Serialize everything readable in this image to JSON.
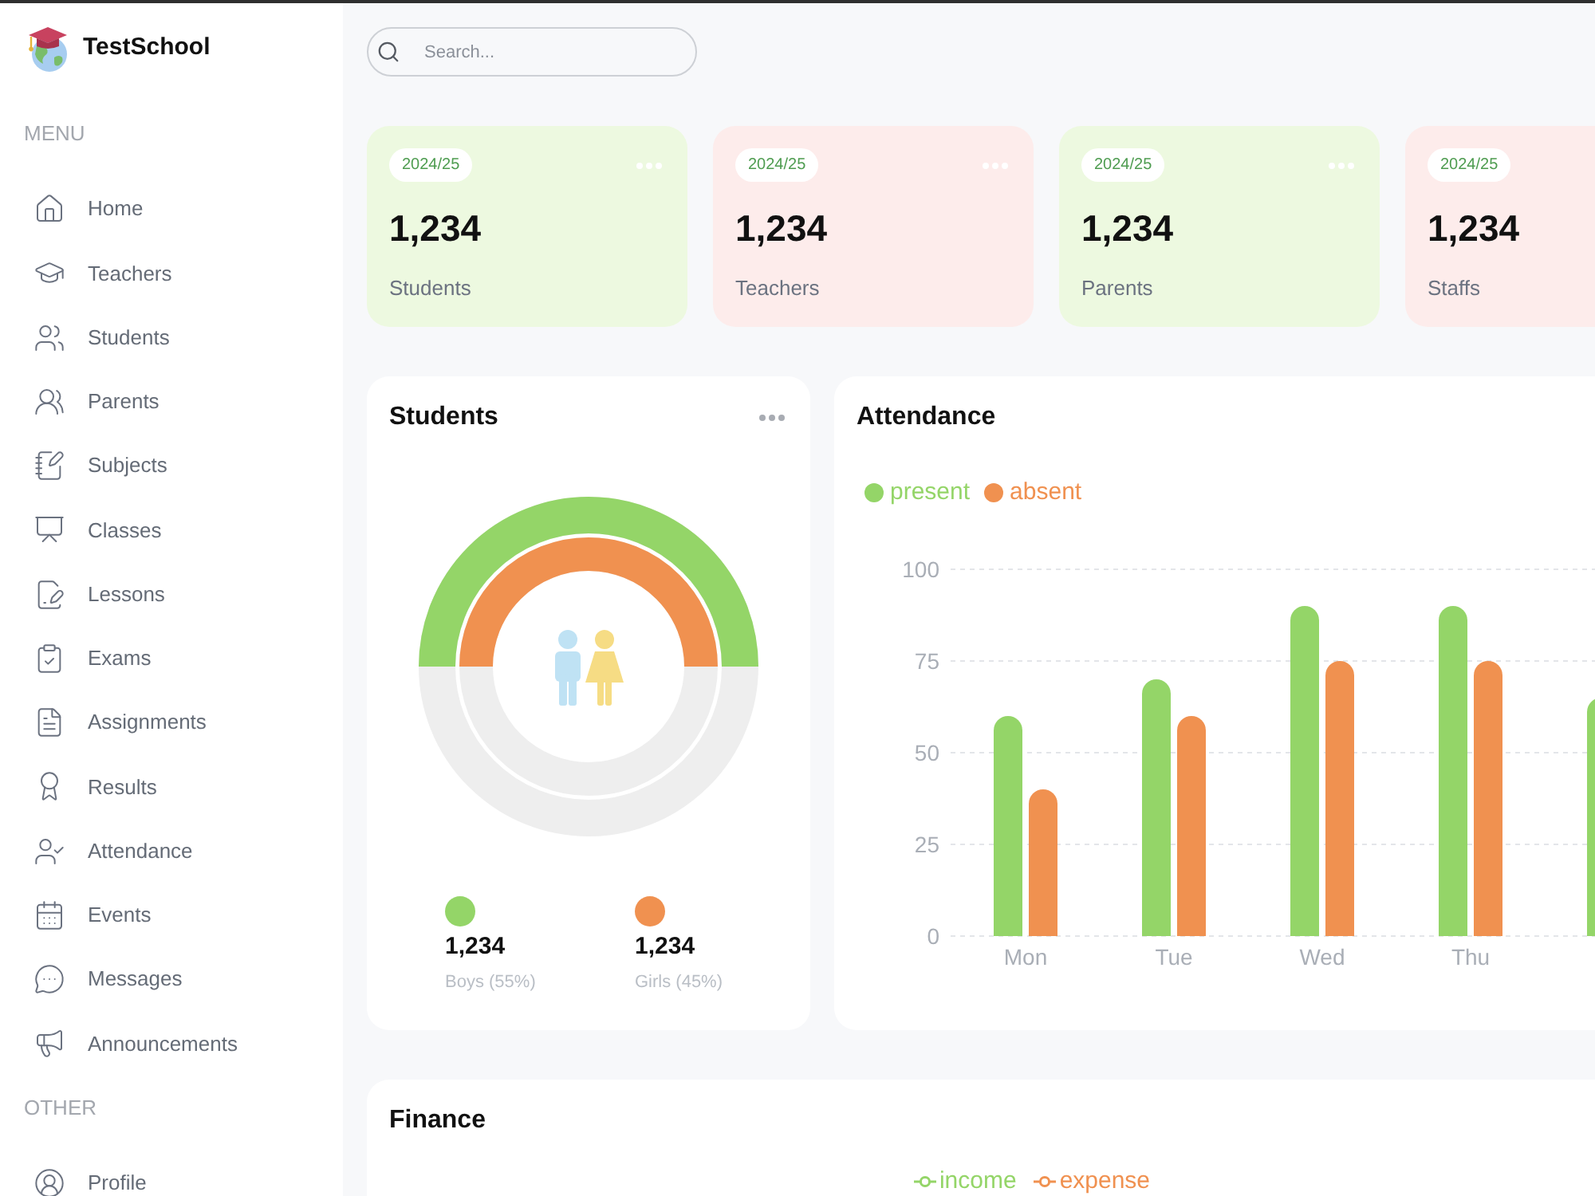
{
  "sidebar": {
    "brand": "TestSchool",
    "sections": [
      {
        "title": "MENU",
        "items": [
          "Home",
          "Teachers",
          "Students",
          "Parents",
          "Subjects",
          "Classes",
          "Lessons",
          "Exams",
          "Assignments",
          "Results",
          "Attendance",
          "Events",
          "Messages",
          "Announcements"
        ]
      },
      {
        "title": "OTHER",
        "items": [
          "Profile"
        ]
      }
    ]
  },
  "search": {
    "placeholder": "Search..."
  },
  "stat_cards": [
    {
      "badge": "2024/25",
      "value": "1,234",
      "label": "Students",
      "color": "#edf9e0"
    },
    {
      "badge": "2024/25",
      "value": "1,234",
      "label": "Teachers",
      "color": "#fdeceb"
    },
    {
      "badge": "2024/25",
      "value": "1,234",
      "label": "Parents",
      "color": "#edf9e0"
    },
    {
      "badge": "2024/25",
      "value": "1,234",
      "label": "Staffs",
      "color": "#fdeceb"
    }
  ],
  "students": {
    "title": "Students",
    "groups": [
      {
        "value": "1,234",
        "label": "Boys (55%)",
        "color": "#94d568"
      },
      {
        "value": "1,234",
        "label": "Girls (45%)",
        "color": "#f09150"
      }
    ]
  },
  "attendance": {
    "title": "Attendance",
    "chart_data": {
      "type": "bar",
      "categories": [
        "Mon",
        "Tue",
        "Wed",
        "Thu",
        null
      ],
      "series": [
        {
          "name": "present",
          "color": "#94d568",
          "values": [
            60,
            70,
            90,
            90,
            65
          ]
        },
        {
          "name": "absent",
          "color": "#f09150",
          "values": [
            40,
            60,
            75,
            75,
            null
          ]
        }
      ],
      "ylim": [
        0,
        100
      ],
      "yticks": [
        0,
        25,
        50,
        75,
        100
      ],
      "grid": true
    }
  },
  "finance": {
    "title": "Finance",
    "legend": [
      {
        "name": "income",
        "color": "#94d568"
      },
      {
        "name": "expense",
        "color": "#f09150"
      }
    ]
  }
}
